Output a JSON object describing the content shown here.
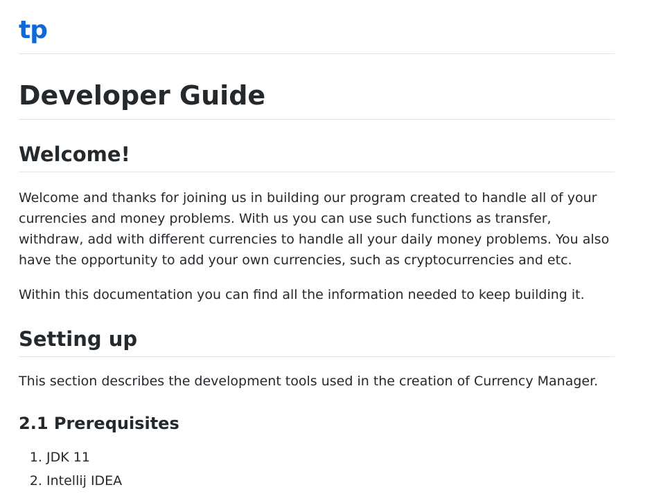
{
  "site": {
    "title": "tp"
  },
  "page": {
    "title": "Developer Guide"
  },
  "welcome": {
    "heading": "Welcome!",
    "paragraph1": "Welcome and thanks for joining us in building our program created to handle all of your currencies and money problems. With us you can use such functions as transfer, withdraw, add with different currencies to handle all your daily money problems. You also have the opportunity to add your own currencies, such as cryptocurrencies and etc.",
    "paragraph2": "Within this documentation you can find all the information needed to keep building it."
  },
  "setup": {
    "heading": "Setting up",
    "paragraph": "This section describes the development tools used in the creation of Currency Manager.",
    "prerequisites": {
      "heading": "2.1 Prerequisites",
      "items": [
        "JDK 11",
        "Intellij IDEA"
      ]
    }
  },
  "colors": {
    "link": "#0f6ad9",
    "text": "#24292e",
    "divider": "#e1e4e8"
  }
}
